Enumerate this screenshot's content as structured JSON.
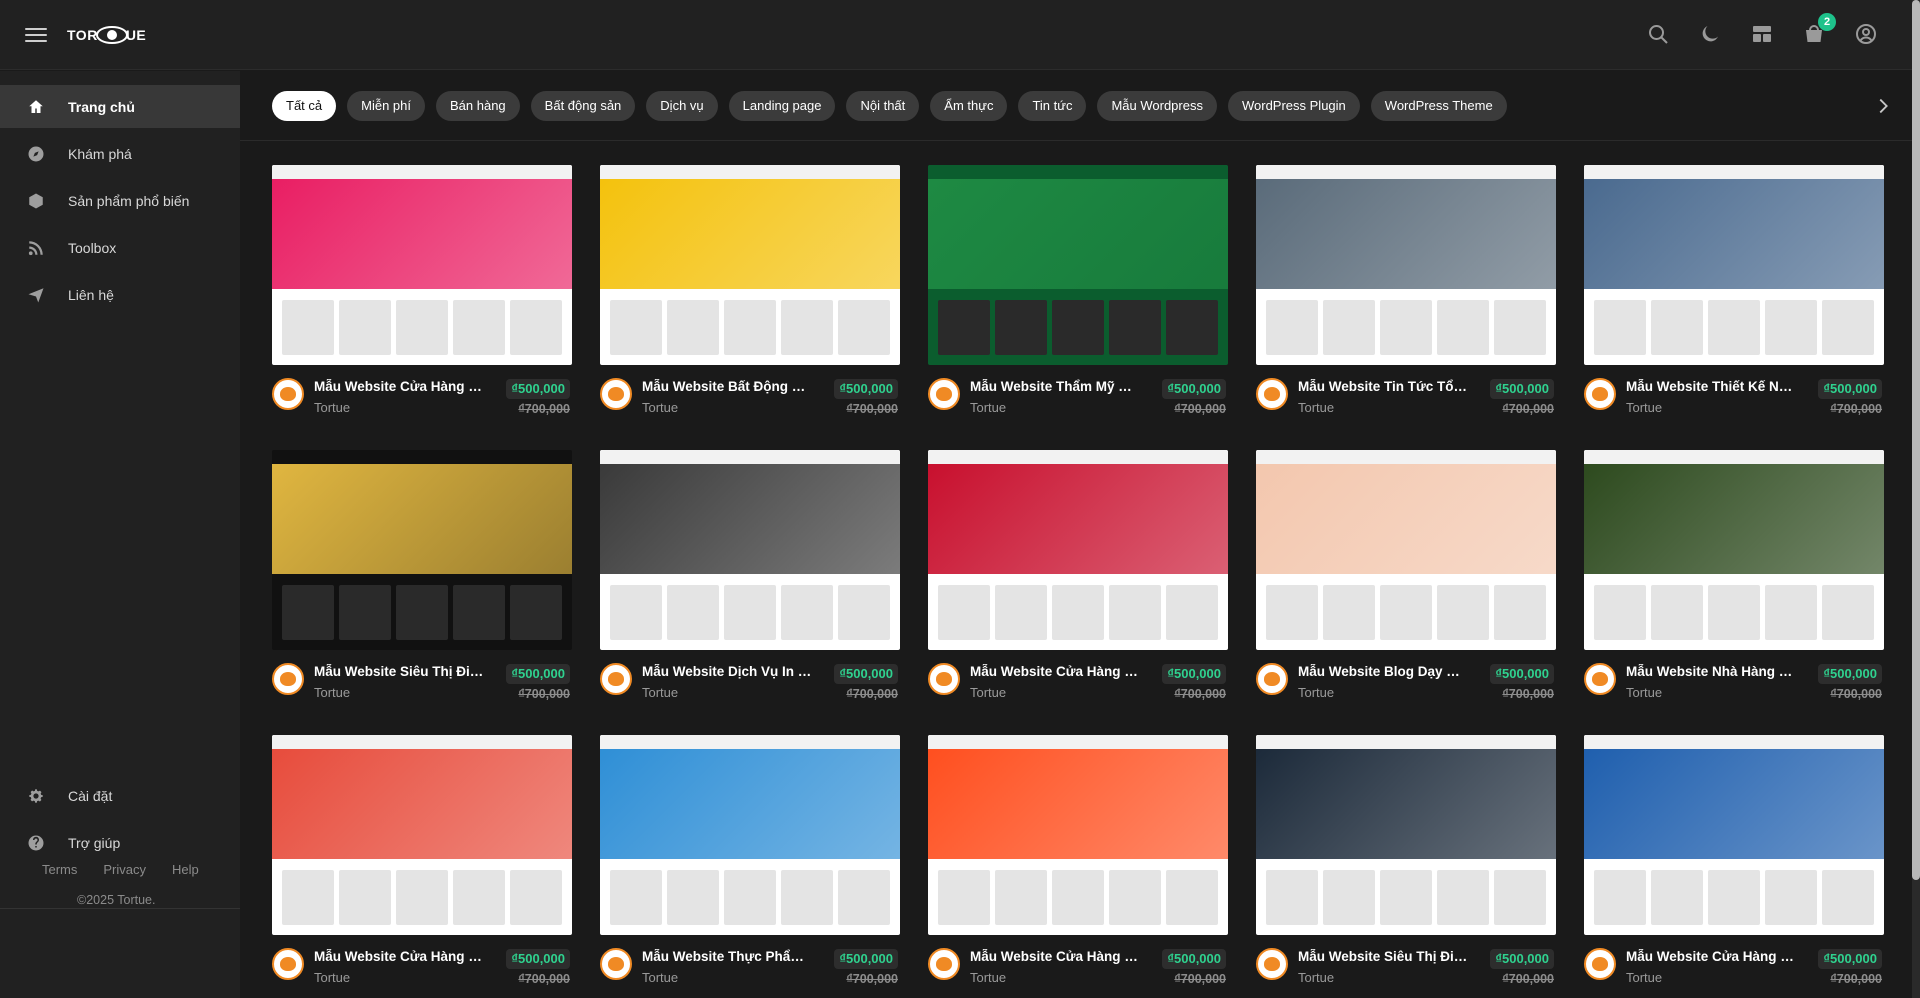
{
  "header": {
    "logo_text_left": "TOR",
    "logo_text_right": "UE",
    "cart_count": "2",
    "icons": [
      "search-icon",
      "moon-icon",
      "layout-icon",
      "cart-icon",
      "user-icon"
    ]
  },
  "sidebar": {
    "items": [
      {
        "label": "Trang chủ",
        "icon": "home-icon"
      },
      {
        "label": "Khám phá",
        "icon": "compass-icon"
      },
      {
        "label": "Sản phẩm phổ biến",
        "icon": "box-icon"
      },
      {
        "label": "Toolbox",
        "icon": "rss-icon"
      },
      {
        "label": "Liên hệ",
        "icon": "send-icon"
      }
    ],
    "bottom_items": [
      {
        "label": "Cài đặt",
        "icon": "gear-icon"
      },
      {
        "label": "Trợ giúp",
        "icon": "help-icon"
      }
    ],
    "footer_links": [
      "Terms",
      "Privacy",
      "Help"
    ],
    "copyright": "©2025 Tortue."
  },
  "chips": [
    "Tất cả",
    "Miễn phí",
    "Bán hàng",
    "Bất động sản",
    "Dịch vụ",
    "Landing page",
    "Nội thất",
    "Ẩm thực",
    "Tin tức",
    "Mẫu Wordpress",
    "WordPress Plugin",
    "WordPress Theme"
  ],
  "products": [
    {
      "title": "Mẫu Website Cửa Hàng Thời Trang",
      "author": "Tortue",
      "price": "₫500,000",
      "old_price": "₫700,000",
      "theme": "#ffffff",
      "accent": "#e91e63"
    },
    {
      "title": "Mẫu Website Bất Động Sản",
      "author": "Tortue",
      "price": "₫500,000",
      "old_price": "₫700,000",
      "theme": "#ffffff",
      "accent": "#f4c20d"
    },
    {
      "title": "Mẫu Website Thẩm Mỹ Viện",
      "author": "Tortue",
      "price": "₫500,000",
      "old_price": "₫700,000",
      "theme": "#0b5d2e",
      "accent": "#1e8a43"
    },
    {
      "title": "Mẫu Website Tin Tức Tổng Hợp",
      "author": "Tortue",
      "price": "₫500,000",
      "old_price": "₫700,000",
      "theme": "#ffffff",
      "accent": "#5a6b7a"
    },
    {
      "title": "Mẫu Website Thiết Kế Nội Thất",
      "author": "Tortue",
      "price": "₫500,000",
      "old_price": "₫700,000",
      "theme": "#ffffff",
      "accent": "#4a6a8f"
    },
    {
      "title": "Mẫu Website Siêu Thị Điện Máy",
      "author": "Tortue",
      "price": "₫500,000",
      "old_price": "₫700,000",
      "theme": "#111111",
      "accent": "#e0b640"
    },
    {
      "title": "Mẫu Website Dịch Vụ In Ấn",
      "author": "Tortue",
      "price": "₫500,000",
      "old_price": "₫700,000",
      "theme": "#ffffff",
      "accent": "#3a3a3a"
    },
    {
      "title": "Mẫu Website Cửa Hàng Bánh",
      "author": "Tortue",
      "price": "₫500,000",
      "old_price": "₫700,000",
      "theme": "#ffffff",
      "accent": "#c8102e"
    },
    {
      "title": "Mẫu Website Blog Dạy Nấu Ăn",
      "author": "Tortue",
      "price": "₫500,000",
      "old_price": "₫700,000",
      "theme": "#ffffff",
      "accent": "#f3c7ae"
    },
    {
      "title": "Mẫu Website Nhà Hàng Ẩm Thực",
      "author": "Tortue",
      "price": "₫500,000",
      "old_price": "₫700,000",
      "theme": "#ffffff",
      "accent": "#2d4a1e"
    },
    {
      "title": "Mẫu Website Cửa Hàng Văn Phòng Phẩm",
      "author": "Tortue",
      "price": "₫500,000",
      "old_price": "₫700,000",
      "theme": "#ffffff",
      "accent": "#e74c3c"
    },
    {
      "title": "Mẫu Website Thực Phẩm Chức Năng",
      "author": "Tortue",
      "price": "₫500,000",
      "old_price": "₫700,000",
      "theme": "#ffffff",
      "accent": "#2f8fd6"
    },
    {
      "title": "Mẫu Website Cửa Hàng Thời Trang",
      "author": "Tortue",
      "price": "₫500,000",
      "old_price": "₫700,000",
      "theme": "#ffffff",
      "accent": "#ff4f1f"
    },
    {
      "title": "Mẫu Website Siêu Thị Điện Máy",
      "author": "Tortue",
      "price": "₫500,000",
      "old_price": "₫700,000",
      "theme": "#ffffff",
      "accent": "#1c2a3a"
    },
    {
      "title": "Mẫu Website Cửa Hàng Sách",
      "author": "Tortue",
      "price": "₫500,000",
      "old_price": "₫700,000",
      "theme": "#ffffff",
      "accent": "#1f5fae"
    }
  ]
}
